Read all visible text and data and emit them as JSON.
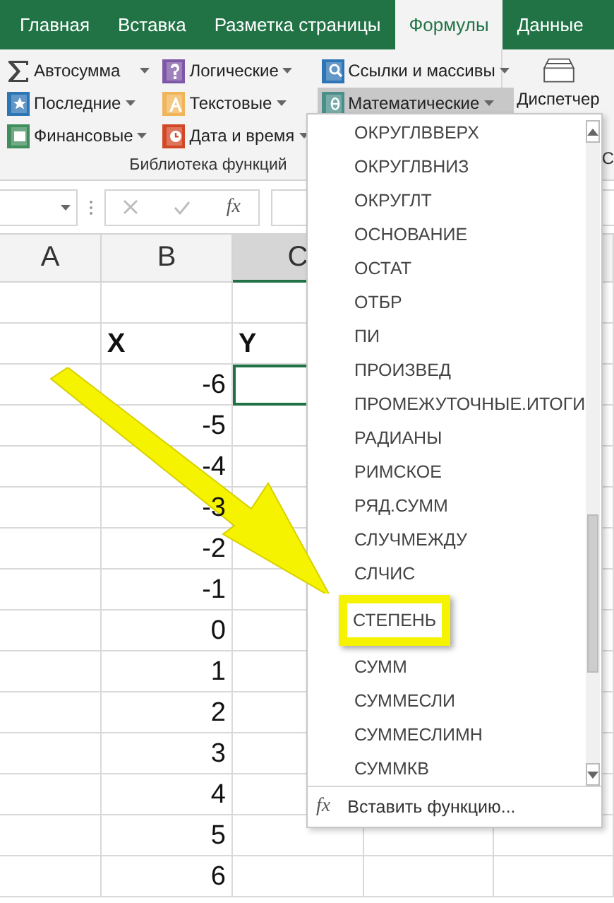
{
  "tabs": [
    {
      "label": "Главная",
      "selected": false
    },
    {
      "label": "Вставка",
      "selected": false
    },
    {
      "label": "Разметка страницы",
      "selected": false
    },
    {
      "label": "Формулы",
      "selected": true
    },
    {
      "label": "Данные",
      "selected": false
    }
  ],
  "ribbon": {
    "columns": [
      [
        {
          "label": "Автосумма",
          "pressed": false
        },
        {
          "label": "Последние",
          "pressed": false
        },
        {
          "label": "Финансовые",
          "pressed": false
        }
      ],
      [
        {
          "label": "Логические",
          "pressed": false
        },
        {
          "label": "Текстовые",
          "pressed": false
        },
        {
          "label": "Дата и время",
          "pressed": false
        }
      ],
      [
        {
          "label": "Ссылки и массивы",
          "pressed": false
        },
        {
          "label": "Математические",
          "pressed": true
        }
      ]
    ],
    "group_label": "Библиотека функций",
    "next_button": "Диспетчер",
    "next_group_label": "С"
  },
  "formula_bar": {
    "function_symbol": "fx"
  },
  "columns": [
    {
      "label": "A",
      "selected": false
    },
    {
      "label": "B",
      "selected": false
    },
    {
      "label": "C",
      "selected": true
    }
  ],
  "rows": [
    {
      "c_selected": false
    },
    {
      "b": "X",
      "c": "Y",
      "c_selected": false
    },
    {
      "b": "-6",
      "c_selected": true
    },
    {
      "b": "-5",
      "c_selected": false
    },
    {
      "b": "-4",
      "c_selected": false
    },
    {
      "b": "-3",
      "c_selected": false
    },
    {
      "b": "-2",
      "c_selected": false
    },
    {
      "b": "-1",
      "c_selected": false
    },
    {
      "b": "0",
      "c_selected": false
    },
    {
      "b": "1",
      "c_selected": false
    },
    {
      "b": "2",
      "c_selected": false
    },
    {
      "b": "3",
      "c_selected": false
    },
    {
      "b": "4",
      "c_selected": false
    },
    {
      "b": "5",
      "c_selected": false
    },
    {
      "b": "6",
      "c_selected": false
    }
  ],
  "dropdown": {
    "items": [
      {
        "label": "ОКРУГЛВВЕРХ",
        "highlighted": false
      },
      {
        "label": "ОКРУГЛВНИЗ",
        "highlighted": false
      },
      {
        "label": "ОКРУГЛТ",
        "highlighted": false
      },
      {
        "label": "ОСНОВАНИЕ",
        "highlighted": false
      },
      {
        "label": "ОСТАТ",
        "highlighted": false
      },
      {
        "label": "ОТБР",
        "highlighted": false
      },
      {
        "label": "ПИ",
        "highlighted": false
      },
      {
        "label": "ПРОИЗВЕД",
        "highlighted": false
      },
      {
        "label": "ПРОМЕЖУТОЧНЫЕ.ИТОГИ",
        "highlighted": false
      },
      {
        "label": "РАДИАНЫ",
        "highlighted": false
      },
      {
        "label": "РИМСКОЕ",
        "highlighted": false
      },
      {
        "label": "РЯД.СУММ",
        "highlighted": false
      },
      {
        "label": "СЛУЧМЕЖДУ",
        "highlighted": false
      },
      {
        "label": "СЛЧИС",
        "highlighted": false
      },
      {
        "label": "СТЕПЕНЬ",
        "highlighted": true
      },
      {
        "label": "СУММ",
        "highlighted": false
      },
      {
        "label": "СУММЕСЛИ",
        "highlighted": false
      },
      {
        "label": "СУММЕСЛИМН",
        "highlighted": false
      },
      {
        "label": "СУММКВ",
        "highlighted": false
      }
    ],
    "footer_symbol": "fx",
    "footer_label": "Вставить функцию..."
  }
}
